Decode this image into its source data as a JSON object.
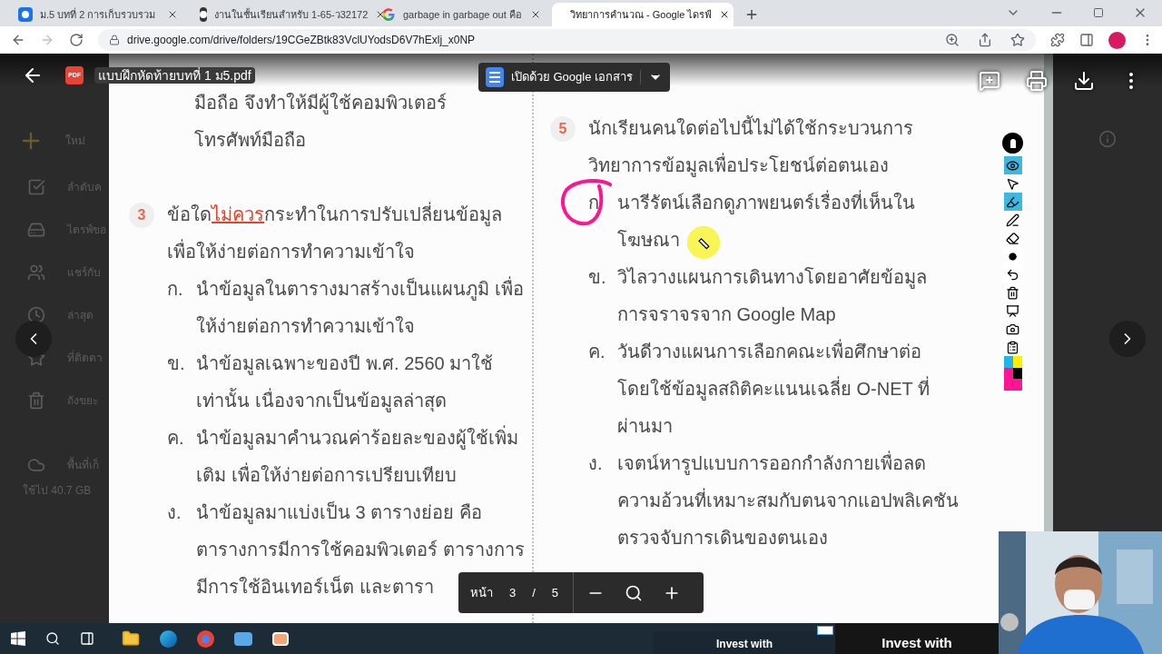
{
  "browser": {
    "tabs": [
      {
        "title": "ม.5 บทที่ 2 การเก็บรวบรวม",
        "selected": false
      },
      {
        "title": "งานในชั้นเรียนสำหรับ 1-65-ว32172",
        "selected": false
      },
      {
        "title": "garbage in garbage out คือ",
        "selected": false
      },
      {
        "title": "วิทยาการคำนวณ - Google ไดรฟ์",
        "selected": true
      }
    ],
    "url": "drive.google.com/drive/folders/19CGeZBtk83VclUYodsD6V7hExlj_x0NP"
  },
  "drive_sidebar": {
    "new_label": "ใหม่",
    "items": [
      {
        "label": "ลำดับค"
      },
      {
        "label": "ไดรฟ์ขอ"
      },
      {
        "label": "แชร์กับ"
      },
      {
        "label": "ล่าสุด"
      },
      {
        "label": "ที่ติดดา"
      },
      {
        "label": "ถังขยะ"
      },
      {
        "label": "พื้นที่เก็"
      }
    ],
    "storage": "ใช้ไป 40.7 GB"
  },
  "viewer": {
    "file_name": "แบบฝึกหัดท้ายบทที่ 1 ม5.pdf",
    "file_badge": "PDF",
    "open_with": "เปิดด้วย Google เอกสาร"
  },
  "document": {
    "columns": [
      {
        "blocks": [
          {
            "kind": "continuation",
            "lines": [
              "มือถือ จึงทำให้มีผู้ใช้คอมพิวเตอร์",
              "โทรศัพท์มือถือ"
            ]
          },
          {
            "kind": "question",
            "number": "3",
            "lines": [
              [
                {
                  "text": "ข้อใด",
                  "emphasis": false
                },
                {
                  "text": "ไม่ควร",
                  "emphasis": true
                },
                {
                  "text": "กระทำในการปรับเปลี่ยนข้อมูล",
                  "emphasis": false
                }
              ],
              [
                {
                  "text": "เพื่อให้ง่ายต่อการทำความเข้าใจ",
                  "emphasis": false
                }
              ]
            ],
            "options": [
              {
                "label": "ก.",
                "circled": false,
                "lines": [
                  "นำข้อมูลในตารางมาสร้างเป็นแผนภูมิ เพื่อ",
                  "ให้ง่ายต่อการทำความเข้าใจ"
                ]
              },
              {
                "label": "ข.",
                "circled": false,
                "lines": [
                  "นำข้อมูลเฉพาะของปี พ.ศ. 2560 มาใช้",
                  "เท่านั้น เนื่องจากเป็นข้อมูลล่าสุด"
                ]
              },
              {
                "label": "ค.",
                "circled": false,
                "lines": [
                  "นำข้อมูลมาคำนวณค่าร้อยละของผู้ใช้เพิ่ม",
                  "เติม เพื่อให้ง่ายต่อการเปรียบเทียบ"
                ]
              },
              {
                "label": "ง.",
                "circled": false,
                "lines": [
                  "นำข้อมูลมาแบ่งเป็น 3 ตารางย่อย คือ",
                  "ตารางการมีการใช้คอมพิวเตอร์ ตารางการ",
                  "มีการใช้อินเทอร์เน็ต และตารา"
                ]
              }
            ]
          }
        ]
      },
      {
        "blocks": [
          {
            "kind": "question",
            "number": "5",
            "lines": [
              [
                {
                  "text": "นักเรียนคนใดต่อไปนี้ไม่ได้ใช้กระบวนการ",
                  "emphasis": false
                }
              ],
              [
                {
                  "text": "วิทยาการข้อมูลเพื่อประโยชน์ต่อตนเอง",
                  "emphasis": false
                }
              ]
            ],
            "options": [
              {
                "label": "ก",
                "circled": true,
                "lines": [
                  "นารีรัตน์เลือกดูภาพยนตร์เรื่องที่เห็นใน",
                  "โฆษณา"
                ]
              },
              {
                "label": "ข.",
                "circled": false,
                "lines": [
                  "วิไลวางแผนการเดินทางโดยอาศัยข้อมูล",
                  "การจราจรจาก Google Map"
                ]
              },
              {
                "label": "ค.",
                "circled": false,
                "lines": [
                  "วันดีวางแผนการเลือกคณะเพื่อศึกษาต่อ",
                  "โดยใช้ข้อมูลสถิติคะแนนเฉลี่ย O-NET ที่",
                  "ผ่านมา"
                ]
              },
              {
                "label": "ง.",
                "circled": false,
                "lines": [
                  "เจตน์หารูปแบบการออกกำลังกายเพื่อลด",
                  "ความอ้วนที่เหมาะสมกับตนจากแอปพลิเคชัน",
                  "ตรวจจับการเดินของตนเอง"
                ]
              }
            ]
          }
        ]
      }
    ]
  },
  "page_nav": {
    "label": "หน้า",
    "current": "3",
    "separator": "/",
    "total": "5"
  },
  "annotation_tools": [
    {
      "kind": "eye",
      "selected": true
    },
    {
      "kind": "pointer",
      "selected": false
    },
    {
      "kind": "marker",
      "selected": true
    },
    {
      "kind": "pen",
      "selected": false
    },
    {
      "kind": "eraser",
      "selected": false
    },
    {
      "kind": "dot",
      "selected": false
    },
    {
      "kind": "undo",
      "selected": false
    },
    {
      "kind": "trash",
      "selected": false
    },
    {
      "kind": "board",
      "selected": false
    },
    {
      "kind": "camera",
      "selected": false
    },
    {
      "kind": "clipboard",
      "selected": false
    }
  ],
  "ads": [
    "Invest with",
    "Invest with"
  ]
}
